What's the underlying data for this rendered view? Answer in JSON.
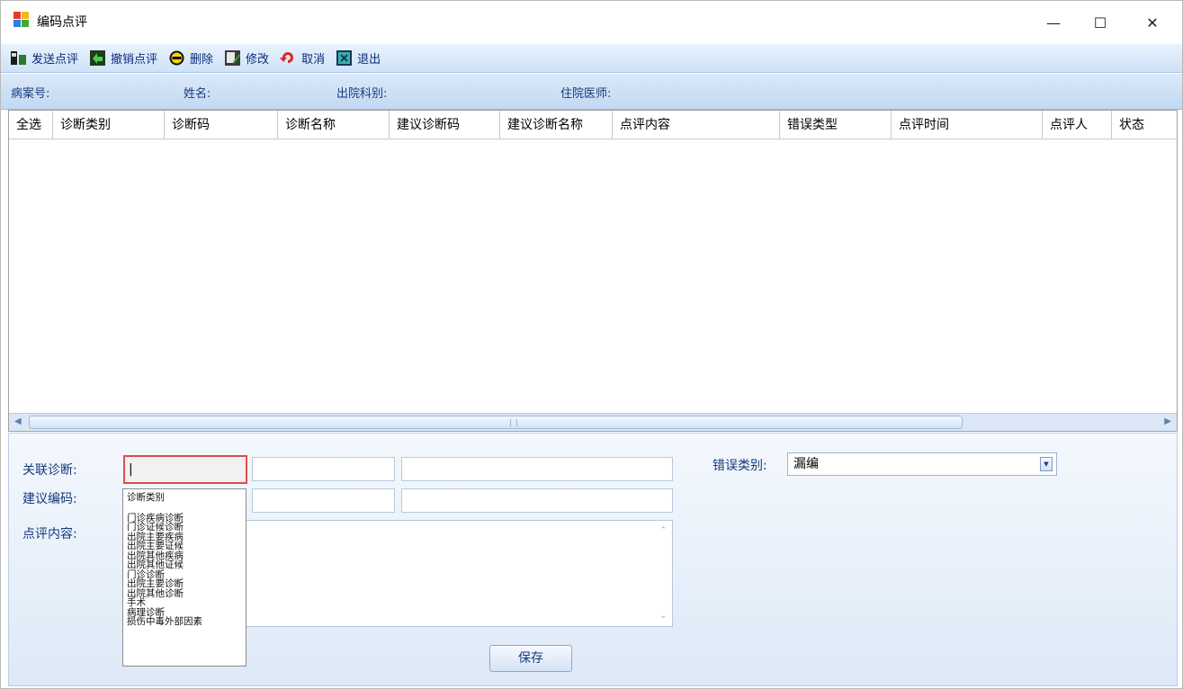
{
  "window": {
    "title": "编码点评",
    "minimize": "—",
    "maximize": "☐",
    "close": "✕"
  },
  "toolbar": {
    "items": [
      {
        "label": "发送点评",
        "icon": "send-review-icon"
      },
      {
        "label": "撤销点评",
        "icon": "undo-review-icon"
      },
      {
        "label": "删除",
        "icon": "delete-icon"
      },
      {
        "label": "修改",
        "icon": "edit-icon"
      },
      {
        "label": "取消",
        "icon": "cancel-icon"
      },
      {
        "label": "退出",
        "icon": "exit-icon"
      }
    ]
  },
  "info": {
    "record_no_label": "病案号:",
    "name_label": "姓名:",
    "discharge_dept_label": "出院科别:",
    "doctor_label": "住院医师:"
  },
  "grid": {
    "columns": [
      "全选",
      "诊断类别",
      "诊断码",
      "诊断名称",
      "建议诊断码",
      "建议诊断名称",
      "点评内容",
      "错误类型",
      "点评时间",
      "点评人",
      "状态"
    ],
    "rows": []
  },
  "form": {
    "related_diag_label": "关联诊断:",
    "related_diag_value": "|",
    "suggest_code_label": "建议编码:",
    "comment_label": "点评内容:",
    "error_type_label": "错误类别:",
    "error_type_value": "漏编",
    "save_label": "保存"
  },
  "dropdown": {
    "header": "诊断类别",
    "items": [
      "门诊疾病诊断",
      "门诊证候诊断",
      "出院主要疾病",
      "出院主要证候",
      "出院其他疾病",
      "出院其他证候",
      "门诊诊断",
      "出院主要诊断",
      "出院其他诊断",
      "手术",
      "病理诊断",
      "损伤中毒外部因素"
    ]
  },
  "colors": {
    "toolbar_text": "#0b2b7a",
    "label_text": "#133a7a",
    "focus_border": "#e24b4b"
  }
}
